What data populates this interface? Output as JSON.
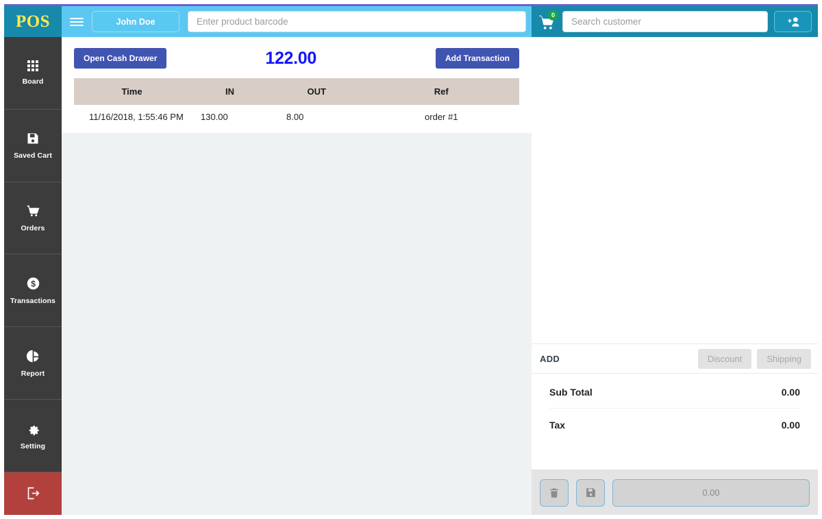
{
  "brand": {
    "logo": "POS"
  },
  "header": {
    "user_name": "John Doe",
    "barcode_placeholder": "Enter product barcode",
    "customer_placeholder": "Search customer",
    "customer_value": "",
    "barcode_value": "",
    "cart_count": "0"
  },
  "sidebar": {
    "items": [
      {
        "label": "Board",
        "icon": "grid-icon"
      },
      {
        "label": "Saved Cart",
        "icon": "floppy-disk-icon"
      },
      {
        "label": "Orders",
        "icon": "shopping-cart-icon"
      },
      {
        "label": "Transactions",
        "icon": "dollar-circle-icon"
      },
      {
        "label": "Report",
        "icon": "pie-chart-icon"
      },
      {
        "label": "Setting",
        "icon": "gear-icon"
      }
    ],
    "logout": {
      "label": "Logout",
      "icon": "logout-icon"
    }
  },
  "transactions": {
    "open_drawer_label": "Open Cash Drawer",
    "add_transaction_label": "Add Transaction",
    "balance": "122.00",
    "columns": [
      "Time",
      "IN",
      "OUT",
      "Ref"
    ],
    "rows": [
      {
        "time": "11/16/2018, 1:55:46 PM",
        "in": "130.00",
        "out": "8.00",
        "ref": "order #1"
      }
    ]
  },
  "cart": {
    "add_label": "ADD",
    "discount_label": "Discount",
    "shipping_label": "Shipping",
    "totals": [
      {
        "label": "Sub Total",
        "value": "0.00"
      },
      {
        "label": "Tax",
        "value": "0.00"
      }
    ],
    "checkout_amount": "0.00"
  },
  "colors": {
    "brand_teal": "#1789ab",
    "header_blue": "#5bc8f2",
    "action_blue": "#4054b2",
    "amount_blue": "#1414ff",
    "badge_green": "#18a54a",
    "logout_red": "#b2413e",
    "table_header": "#d8cdc7"
  }
}
